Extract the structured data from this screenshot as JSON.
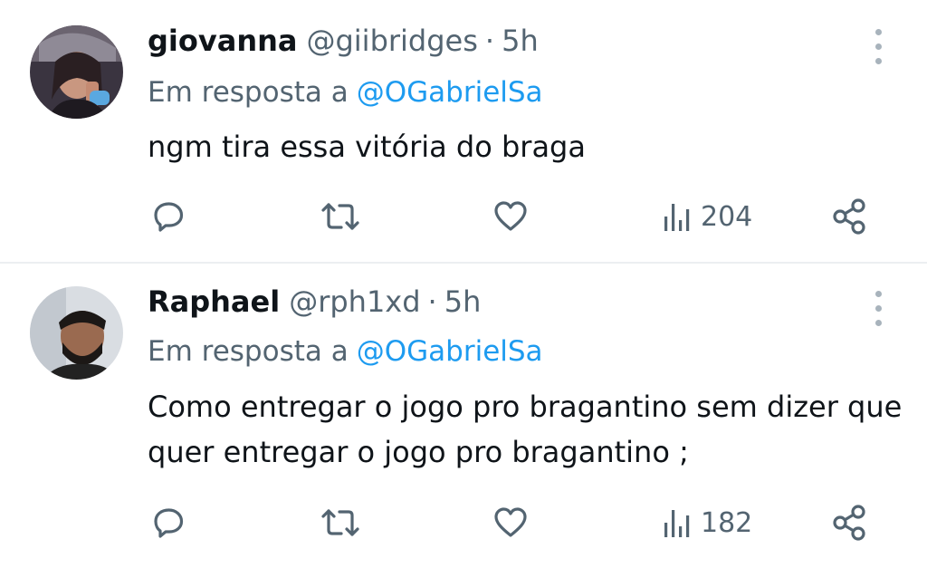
{
  "tweets": [
    {
      "author_name": "giovanna",
      "author_handle": "@giibridges",
      "separator": "·",
      "time": "5h",
      "reply_prefix": "Em resposta a",
      "reply_to": "@OGabrielSa",
      "text": "ngm tira essa vitória do braga",
      "views": "204"
    },
    {
      "author_name": "Raphael",
      "author_handle": "@rph1xd",
      "separator": "·",
      "time": "5h",
      "reply_prefix": "Em resposta a",
      "reply_to": "@OGabrielSa",
      "text": "Como entregar o jogo pro bragantino sem dizer que quer entregar o jogo pro bragantino ;",
      "views": "182"
    }
  ],
  "icons": {
    "reply": "reply-icon",
    "retweet": "retweet-icon",
    "like": "heart-icon",
    "views": "views-icon",
    "share": "share-icon",
    "more": "more-icon"
  },
  "colors": {
    "text": "#0f1419",
    "secondary": "#536471",
    "link": "#1d9bf0",
    "divider": "#eceff1"
  }
}
